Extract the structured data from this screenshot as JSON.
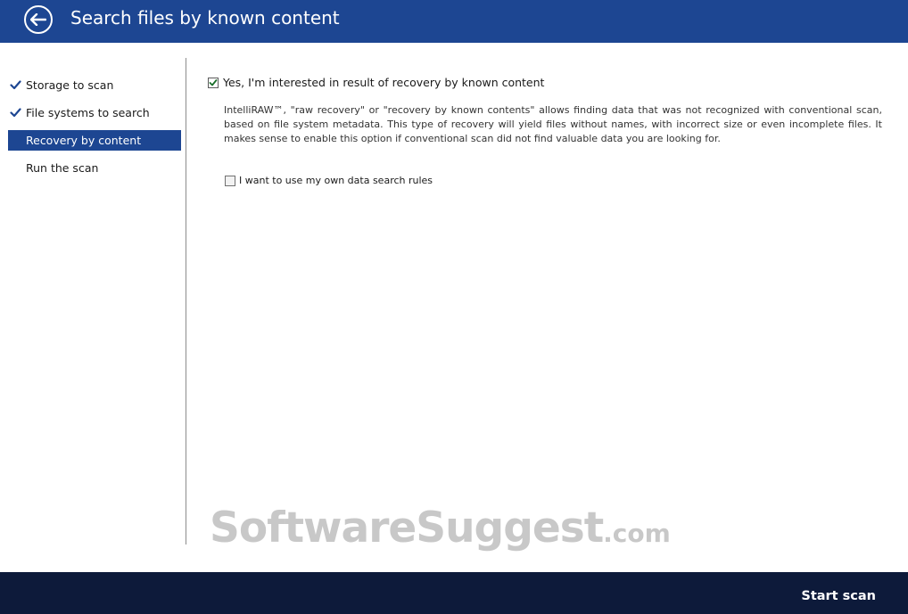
{
  "header": {
    "title": "Search files by known content",
    "back_icon": "arrow-left-icon"
  },
  "sidebar": {
    "steps": [
      {
        "label": "Storage to scan",
        "completed": true,
        "active": false
      },
      {
        "label": "File systems to search",
        "completed": true,
        "active": false
      },
      {
        "label": "Recovery by content",
        "completed": false,
        "active": true
      },
      {
        "label": "Run the scan",
        "completed": false,
        "active": false
      }
    ]
  },
  "main": {
    "interest_checkbox": {
      "label": "Yes, I'm interested in result of recovery by known content",
      "checked": true
    },
    "description": "IntelliRAW™, \"raw recovery\" or \"recovery by known contents\" allows finding data that was not recognized with conventional scan, based on file system metadata. This type of recovery will yield files without names, with incorrect size or even incomplete files. It makes sense to enable this option if conventional scan did not find valuable data you are looking for.",
    "own_rules_checkbox": {
      "label": "I want to use my own data search rules",
      "checked": false
    }
  },
  "watermark": {
    "name": "SoftwareSuggest",
    "tld": ".com"
  },
  "footer": {
    "start_label": "Start scan"
  },
  "colors": {
    "header_bg": "#1d4692",
    "footer_bg": "#0d1a3a",
    "active_step_bg": "#1d4692",
    "check_color": "#1d4692"
  }
}
